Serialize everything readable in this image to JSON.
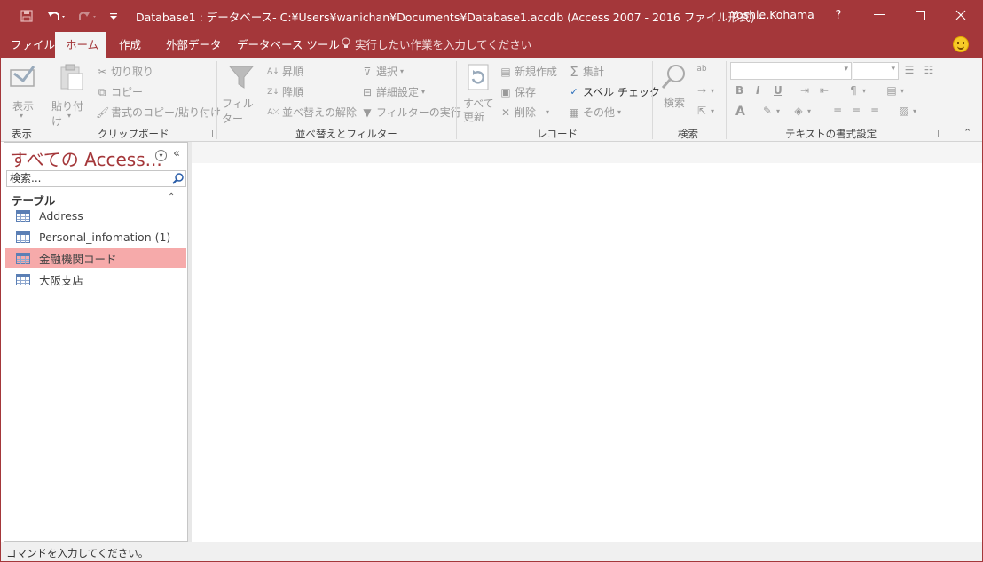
{
  "titlebar": {
    "title": "Database1 : データベース- C:¥Users¥wanichan¥Documents¥Database1.accdb (Access 2007 - 2016 ファイル形式) -⋯",
    "user": "Yoshie Kohama",
    "help": "?",
    "minimize": "—",
    "maximize": "☐",
    "close": "✕"
  },
  "tabs": [
    "ファイル",
    "ホーム",
    "作成",
    "外部データ",
    "データベース ツール"
  ],
  "active_tab": "ホーム",
  "tellme": "実行したい作業を入力してください",
  "ribbon": {
    "view": {
      "label": "表示",
      "group": "表示"
    },
    "clipboard": {
      "paste": "貼り付け",
      "cut": "切り取り",
      "copy": "コピー",
      "format_painter": "書式のコピー/貼り付け",
      "group": "クリップボード"
    },
    "sort_filter": {
      "filter": "フィルター",
      "ascending": "昇順",
      "descending": "降順",
      "remove_sort": "並べ替えの解除",
      "selection": "選択",
      "advanced": "詳細設定",
      "toggle_filter": "フィルターの実行",
      "group": "並べ替えとフィルター"
    },
    "records": {
      "refresh": "すべて\n更新",
      "refresh_line1": "すべて",
      "refresh_line2": "更新",
      "new": "新規作成",
      "save": "保存",
      "delete": "削除",
      "totals": "集計",
      "spelling": "スペル チェック",
      "more": "その他",
      "group": "レコード"
    },
    "find": {
      "find": "検索",
      "group": "検索"
    },
    "text_format": {
      "group": "テキストの書式設定",
      "bold": "B",
      "italic": "I",
      "underline": "U",
      "font_color": "A"
    }
  },
  "nav": {
    "title": "すべての Access...",
    "search_placeholder": "検索...",
    "group_label": "テーブル",
    "items": [
      {
        "label": "Address",
        "selected": false
      },
      {
        "label": "Personal_infomation (1)",
        "selected": false
      },
      {
        "label": "金融機関コード",
        "selected": true
      },
      {
        "label": "大阪支店",
        "selected": false
      }
    ]
  },
  "status": {
    "text": "コマンドを入力してください。"
  },
  "colors": {
    "accent": "#a4373a",
    "selected_row": "#f6aaaa",
    "ribbon_bg": "#f3f3f3"
  }
}
